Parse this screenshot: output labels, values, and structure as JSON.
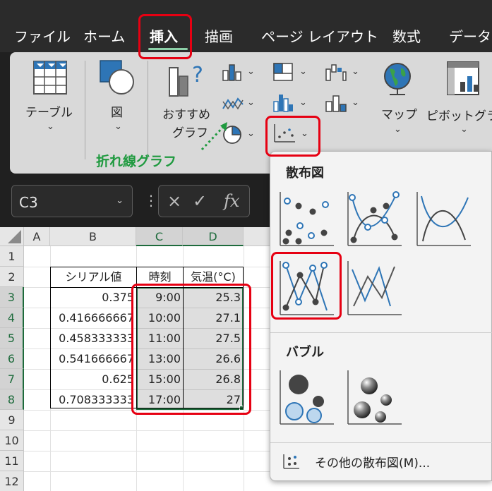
{
  "tabs": [
    {
      "label": "ファイル",
      "active": false
    },
    {
      "label": "ホーム",
      "active": false
    },
    {
      "label": "挿入",
      "active": true
    },
    {
      "label": "描画",
      "active": false
    },
    {
      "label": "ページ レイアウト",
      "active": false
    },
    {
      "label": "数式",
      "active": false
    },
    {
      "label": "データ",
      "active": false
    }
  ],
  "ribbon": {
    "table_label": "テーブル",
    "shape_label": "図",
    "recommended_line1": "おすすめ",
    "recommended_line2": "グラフ",
    "map_label": "マップ",
    "pivot_label": "ピボットグラフ",
    "annotation_label": "折れ線グラフ"
  },
  "name_box": {
    "value": "C3"
  },
  "formula_bar": {
    "cancel_glyph": "×",
    "enter_glyph": "✓",
    "fx_glyph": "fx"
  },
  "columns": [
    "A",
    "B",
    "C",
    "D"
  ],
  "rows": [
    "1",
    "2",
    "3",
    "4",
    "5",
    "6",
    "7",
    "8",
    "9",
    "10",
    "11",
    "12"
  ],
  "table": {
    "headers": [
      "シリアル値",
      "時刻",
      "気温(°C)"
    ],
    "rows": [
      [
        "0.375",
        "9:00",
        "25.3"
      ],
      [
        "0.416666667",
        "10:00",
        "27.1"
      ],
      [
        "0.458333333",
        "11:00",
        "27.5"
      ],
      [
        "0.541666667",
        "13:00",
        "26.6"
      ],
      [
        "0.625",
        "15:00",
        "26.8"
      ],
      [
        "0.708333333",
        "17:00",
        "27"
      ]
    ]
  },
  "gallery": {
    "scatter_heading": "散布図",
    "bubble_heading": "バブル",
    "more_label": "その他の散布図(M)...",
    "more_accel": "M"
  },
  "colors": {
    "accent_green": "#1e6b3c",
    "annotation_red": "#e60012",
    "annotation_green": "#1f9a3f",
    "series_blue": "#2e75b6"
  }
}
